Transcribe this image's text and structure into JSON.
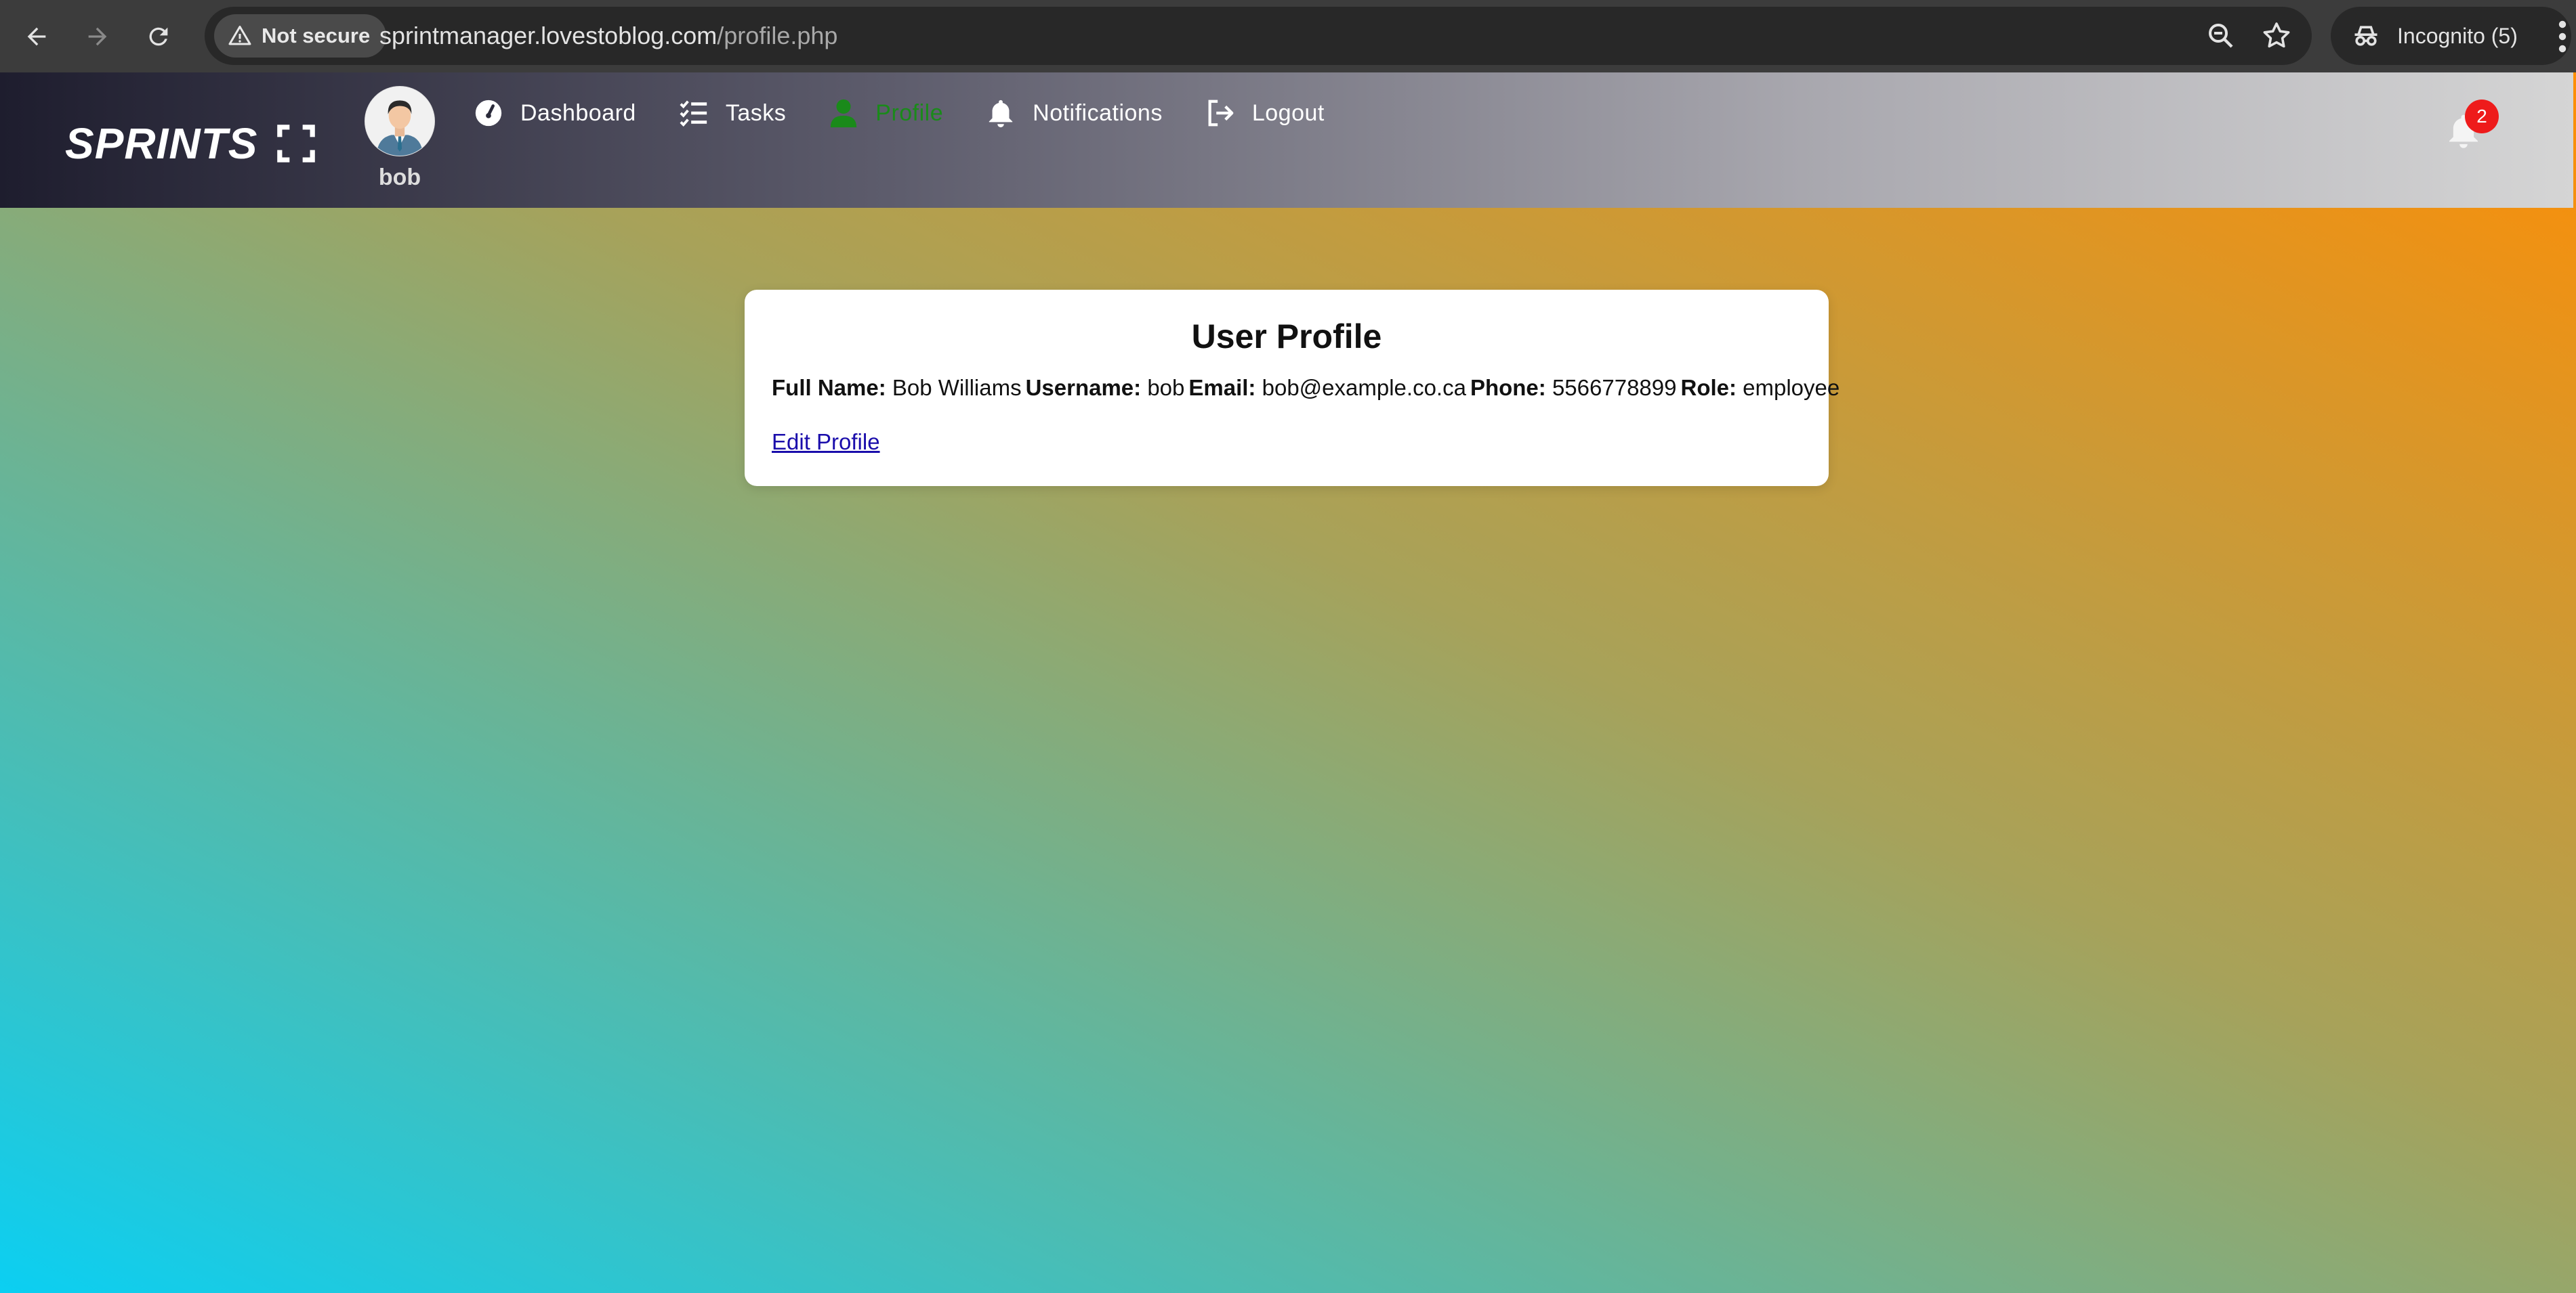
{
  "browser": {
    "security_label": "Not secure",
    "url_host": "sprintmanager.lovestoblog.com",
    "url_path": "/profile.php",
    "incognito_label": "Incognito (5)"
  },
  "app": {
    "logo_text": "SPRINTS",
    "user": {
      "name": "bob"
    },
    "nav": [
      {
        "label": "Dashboard",
        "icon": "gauge-icon"
      },
      {
        "label": "Tasks",
        "icon": "task-list-icon"
      },
      {
        "label": "Profile",
        "icon": "user-icon",
        "active": true
      },
      {
        "label": "Notifications",
        "icon": "bell-icon"
      },
      {
        "label": "Logout",
        "icon": "logout-icon"
      }
    ],
    "notification_count": "2",
    "colors": {
      "active_nav": "#1a8a1a",
      "badge": "#ee1b1b",
      "link": "#1a0dab"
    }
  },
  "profile": {
    "title": "User Profile",
    "fields": [
      {
        "label": "Full Name:",
        "value": "Bob Williams"
      },
      {
        "label": "Username:",
        "value": "bob"
      },
      {
        "label": "Email:",
        "value": "bob@example.co.ca"
      },
      {
        "label": "Phone:",
        "value": "5566778899"
      },
      {
        "label": "Role:",
        "value": "employee"
      }
    ],
    "edit_link": "Edit Profile"
  }
}
